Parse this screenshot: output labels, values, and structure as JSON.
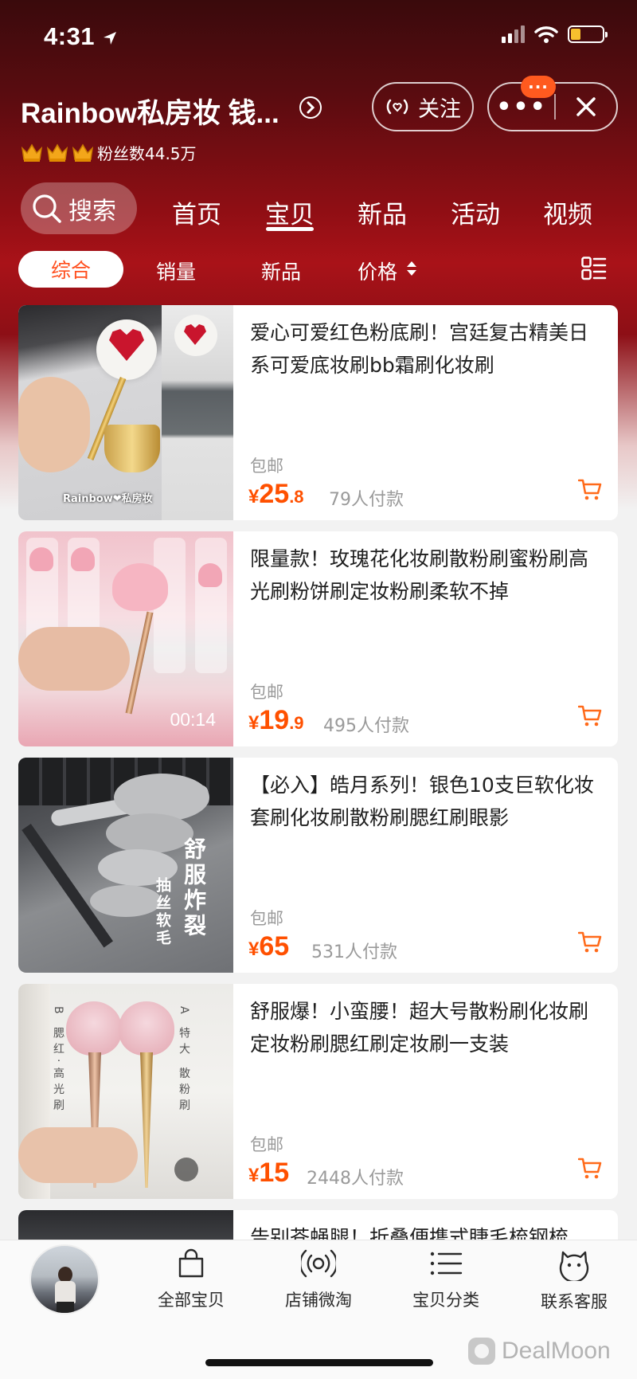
{
  "status_bar": {
    "time": "4:31"
  },
  "header": {
    "shop_name": "Rainbow私房妆 钱...",
    "follow_label": "关注",
    "more_label": "•••",
    "notification_badge": "···",
    "fans_label": "粉丝数44.5万"
  },
  "nav": {
    "search_label": "搜索",
    "tabs": [
      {
        "label": "首页"
      },
      {
        "label": "宝贝",
        "active": true
      },
      {
        "label": "新品"
      },
      {
        "label": "活动"
      },
      {
        "label": "视频"
      }
    ]
  },
  "sort": {
    "options": [
      {
        "label": "综合",
        "selected": true
      },
      {
        "label": "销量"
      },
      {
        "label": "新品"
      },
      {
        "label": "价格"
      }
    ]
  },
  "products": [
    {
      "title": "爱心可爱红色粉底刷！宫廷复古精美日系可爱底妆刷bb霜刷化妆刷",
      "shipping": "包邮",
      "currency": "¥",
      "price_int": "25",
      "price_dec": ".8",
      "paid": "79人付款",
      "thumb_text": "Rainbow❤私房妆"
    },
    {
      "title": "限量款！玫瑰花化妆刷散粉刷蜜粉刷高光刷粉饼刷定妆粉刷柔软不掉",
      "shipping": "包邮",
      "currency": "¥",
      "price_int": "19",
      "price_dec": ".9",
      "paid": "495人付款",
      "video_length": "00:14"
    },
    {
      "title": "【必入】皓月系列！银色10支巨软化妆套刷化妆刷散粉刷腮红刷眼影",
      "shipping": "包邮",
      "currency": "¥",
      "price_int": "65",
      "price_dec": "",
      "paid": "531人付款",
      "thumb_text_1": "舒服炸裂",
      "thumb_text_2": "抽丝软毛"
    },
    {
      "title": "舒服爆！小蛮腰！超大号散粉刷化妆刷定妆粉刷腮红刷定妆刷一支装",
      "shipping": "包邮",
      "currency": "¥",
      "price_int": "15",
      "price_dec": "",
      "paid": "2448人付款",
      "thumb_text_1": "A 特大 散粉刷",
      "thumb_text_2": "B 腮红·高光刷"
    },
    {
      "title": "告别苍蝇腿！折叠便携式睫毛梳钢梳"
    }
  ],
  "bottom_bar": {
    "tabs": [
      {
        "label": "全部宝贝",
        "icon": "bag-icon"
      },
      {
        "label": "店铺微淘",
        "icon": "broadcast-icon"
      },
      {
        "label": "宝贝分类",
        "icon": "list-icon"
      },
      {
        "label": "联系客服",
        "icon": "chat-face-icon"
      }
    ]
  },
  "watermark": "DealMoon",
  "colors": {
    "accent": "#ff5000",
    "header_red": "#a91218"
  }
}
